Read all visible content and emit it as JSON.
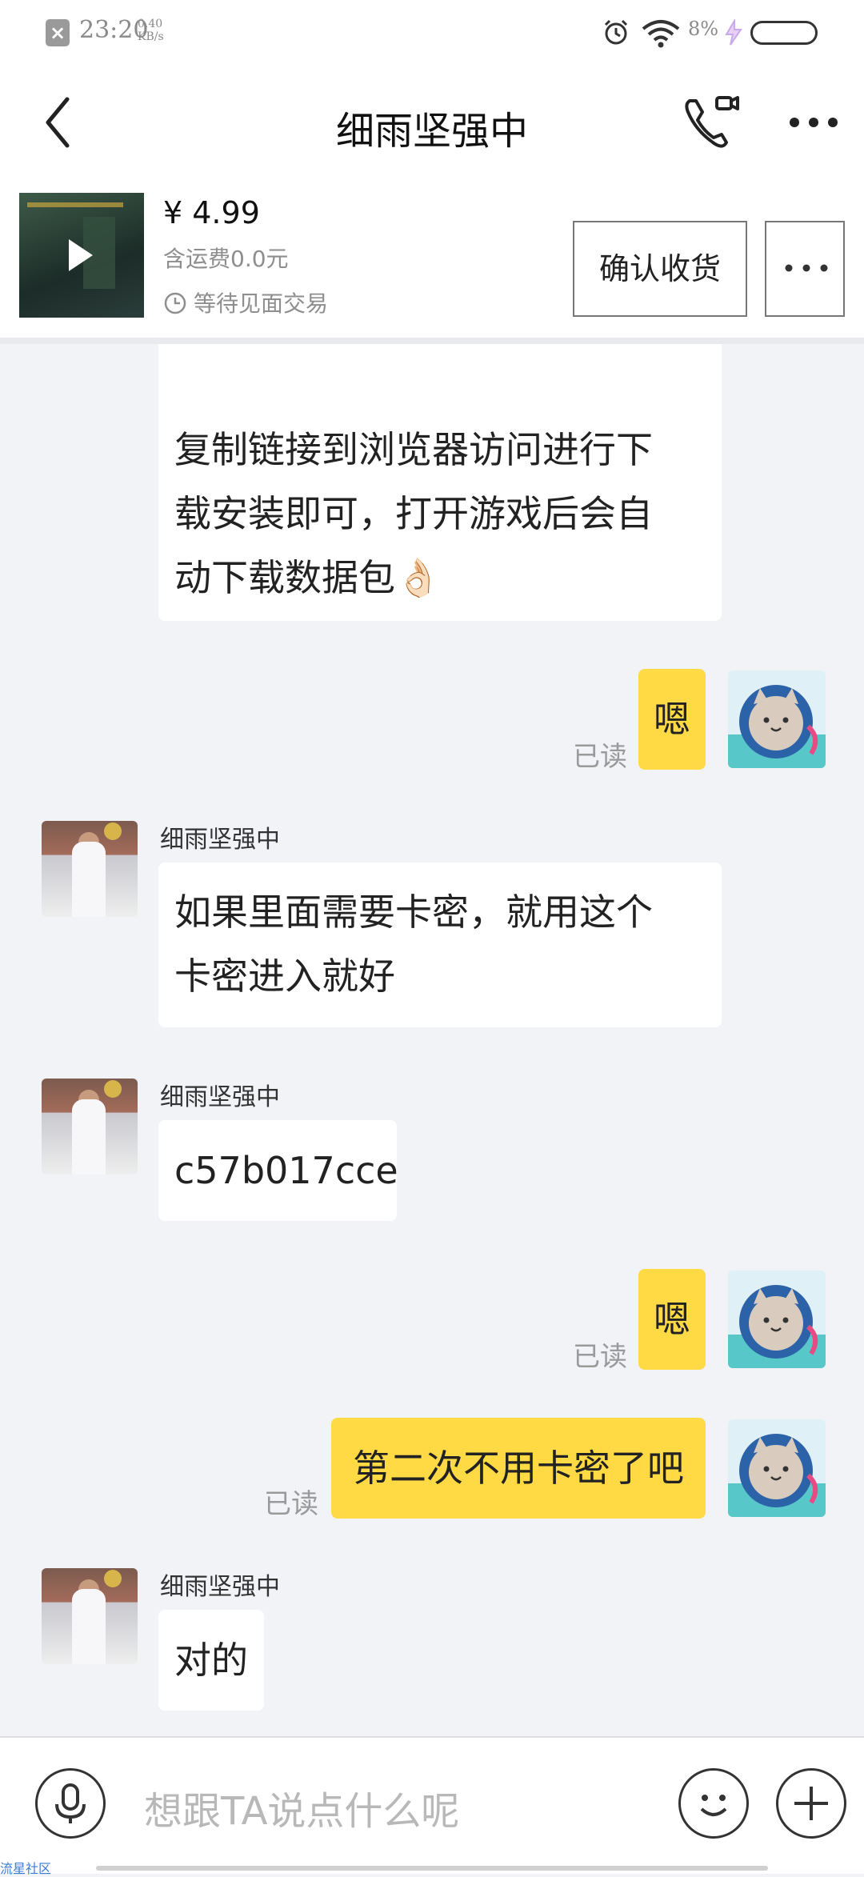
{
  "status_bar": {
    "time": "23:20",
    "net_speed_value": "0.40",
    "net_speed_unit": "KB/s",
    "battery": "8%"
  },
  "header": {
    "title": "细雨坚强中"
  },
  "product": {
    "price": "¥ 4.99",
    "shipping": "含运费0.0元",
    "status": "等待见面交易",
    "confirm_label": "确认收货"
  },
  "messages": [
    {
      "direction": "in",
      "sender": "",
      "lines": [
        "复制链接到浏览器访问进行下",
        "载安装即可，打开游戏后会自",
        "动下载数据包👌🏻"
      ]
    },
    {
      "direction": "out",
      "read": "已读",
      "lines": [
        "嗯"
      ]
    },
    {
      "direction": "in",
      "sender": "细雨坚强中",
      "lines": [
        "如果里面需要卡密，就用这个",
        "卡密进入就好"
      ]
    },
    {
      "direction": "in",
      "sender": "细雨坚强中",
      "lines": [
        "c57b017cce"
      ]
    },
    {
      "direction": "out",
      "read": "已读",
      "lines": [
        "嗯"
      ]
    },
    {
      "direction": "out",
      "read": "已读",
      "lines": [
        "第二次不用卡密了吧"
      ]
    },
    {
      "direction": "in",
      "sender": "细雨坚强中",
      "lines": [
        "对的"
      ]
    }
  ],
  "input": {
    "placeholder": "想跟TA说点什么呢"
  },
  "watermark": "流星社区",
  "colors": {
    "outgoing_bubble": "#ffda44",
    "incoming_bubble": "#ffffff",
    "background": "#f2f3f7"
  },
  "icons": {
    "back": "back-arrow-icon",
    "call": "video-call-icon",
    "more": "more-icon",
    "clock": "clock-icon",
    "mic": "microphone-icon",
    "emoji": "emoji-icon",
    "plus": "plus-icon"
  }
}
